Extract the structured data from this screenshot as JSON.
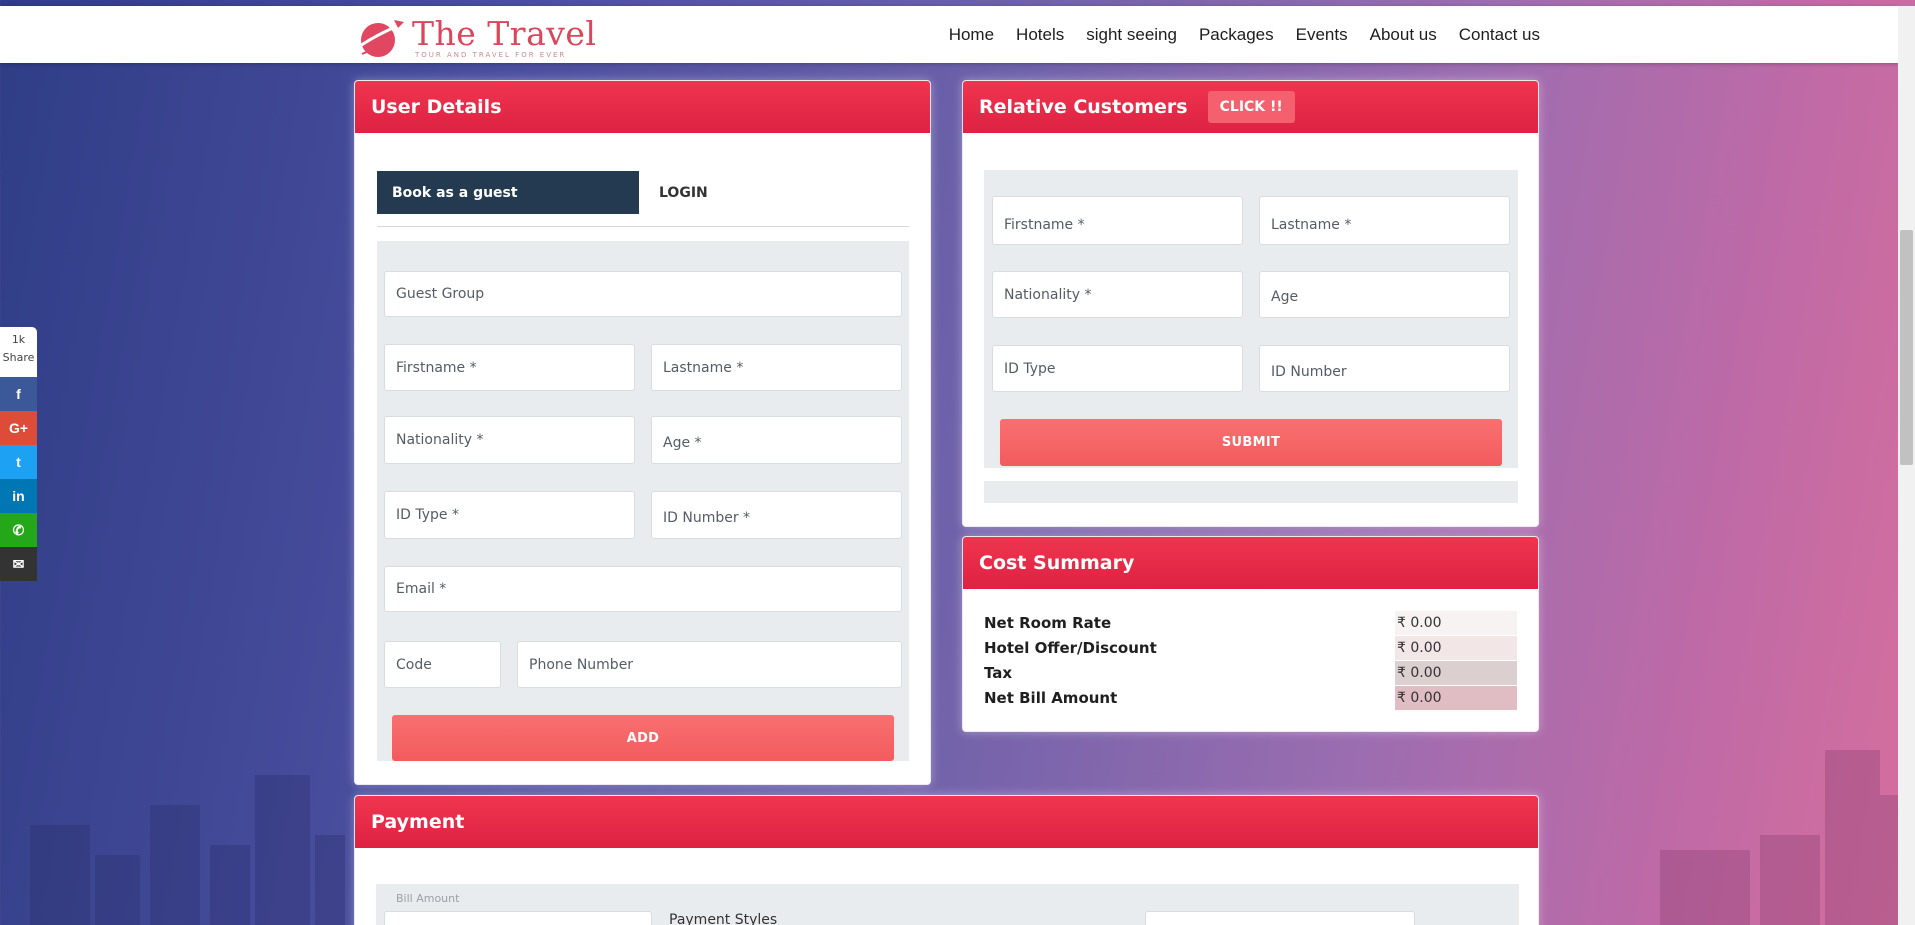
{
  "header": {
    "logo_title": "The Travel",
    "logo_subtitle": "TOUR AND TRAVEL FOR EVER",
    "nav": [
      "Home",
      "Hotels",
      "sight seeing",
      "Packages",
      "Events",
      "About us",
      "Contact us"
    ]
  },
  "share": {
    "count": "1k",
    "label": "Share",
    "buttons": [
      {
        "icon": "facebook-icon",
        "glyph": "f",
        "color": "#3b5998"
      },
      {
        "icon": "google-plus-icon",
        "glyph": "G+",
        "color": "#dd4b39"
      },
      {
        "icon": "twitter-icon",
        "glyph": "t",
        "color": "#1da1f2"
      },
      {
        "icon": "linkedin-icon",
        "glyph": "in",
        "color": "#0077b5"
      },
      {
        "icon": "whatsapp-icon",
        "glyph": "✆",
        "color": "#25a71a"
      },
      {
        "icon": "email-icon",
        "glyph": "✉",
        "color": "#333333"
      }
    ]
  },
  "user_details": {
    "title": "User Details",
    "tabs": {
      "guest": "Book as a guest",
      "login": "LOGIN"
    },
    "fields": {
      "guest_group": "Guest Group",
      "firstname": "Firstname *",
      "lastname": "Lastname *",
      "nationality": "Nationality *",
      "age": "Age *",
      "id_type": "ID Type *",
      "id_number": "ID Number *",
      "email": "Email *",
      "code": "Code",
      "phone": "Phone Number"
    },
    "add_button": "ADD"
  },
  "relative_customers": {
    "title": "Relative Customers",
    "click_button": "CLICK !!",
    "fields": {
      "firstname": "Firstname *",
      "lastname": "Lastname *",
      "nationality": "Nationality *",
      "age": "Age",
      "id_type": "ID Type",
      "id_number": "ID Number"
    },
    "submit_button": "SUBMIT"
  },
  "cost_summary": {
    "title": "Cost Summary",
    "rows": [
      {
        "label": "Net Room Rate",
        "value": "₹ 0.00"
      },
      {
        "label": "Hotel Offer/Discount",
        "value": "₹ 0.00"
      },
      {
        "label": "Tax",
        "value": "₹ 0.00"
      },
      {
        "label": "Net Bill Amount",
        "value": "₹ 0.00"
      }
    ]
  },
  "payment": {
    "title": "Payment",
    "bill_amount_label": "Bill Amount",
    "payment_styles_label": "Payment Styles"
  },
  "colors": {
    "accent_red": "#e8294a",
    "dark_tab": "#243a51",
    "button_red": "#f46466"
  }
}
